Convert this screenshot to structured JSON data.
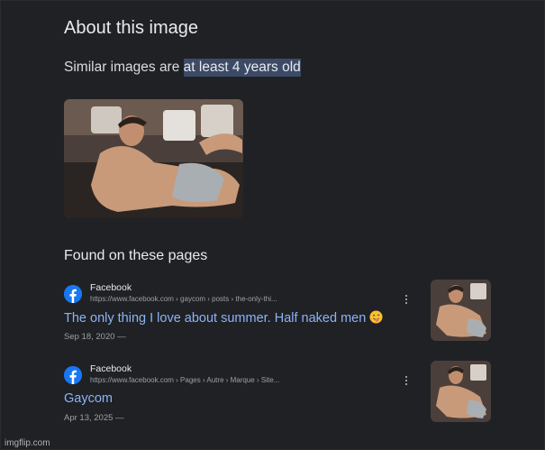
{
  "panel": {
    "title": "About this image",
    "age_prefix": "Similar images are ",
    "age_highlight": "at least 4 years old",
    "found_heading": "Found on these pages"
  },
  "results": [
    {
      "site": "Facebook",
      "url": "https://www.facebook.com › gaycom › posts › the-only-thi...",
      "title": "The only thing I love about summer. Half naked men",
      "date": "Sep 18, 2020 —",
      "emoji_icon": "winking-face-with-tongue-icon"
    },
    {
      "site": "Facebook",
      "url": "https://www.facebook.com › Pages › Autre › Marque › Site...",
      "title": "Gaycom",
      "date": "Apr 13, 2025 —"
    }
  ],
  "watermark": "imgflip.com",
  "colors": {
    "background": "#202124",
    "link": "#8ab4f8",
    "highlight": "#3c4a66",
    "facebook": "#1877f2"
  }
}
